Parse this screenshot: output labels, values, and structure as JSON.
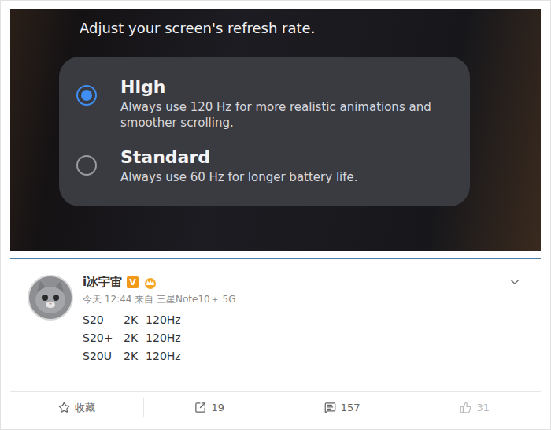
{
  "settings_screen": {
    "title": "Adjust your screen's refresh rate.",
    "options": [
      {
        "label": "High",
        "description": "Always use 120 Hz for more realistic animations and smoother scrolling.",
        "selected": true
      },
      {
        "label": "Standard",
        "description": "Always use 60 Hz for longer battery life.",
        "selected": false
      }
    ]
  },
  "post": {
    "author": "i冰宇宙",
    "verified_badge": "V",
    "meta": "今天 12:44 来自 三星Note10＋ 5G",
    "lines": [
      {
        "model": "S20",
        "resolution": "2K",
        "refresh": "120Hz"
      },
      {
        "model": "S20+",
        "resolution": "2K",
        "refresh": "120Hz"
      },
      {
        "model": "S20U",
        "resolution": "2K",
        "refresh": "120Hz"
      }
    ],
    "actions": [
      {
        "label": "收藏",
        "kind": "favorite"
      },
      {
        "label": "19",
        "kind": "repost"
      },
      {
        "label": "157",
        "kind": "comment"
      },
      {
        "label": "31",
        "kind": "like"
      }
    ]
  }
}
